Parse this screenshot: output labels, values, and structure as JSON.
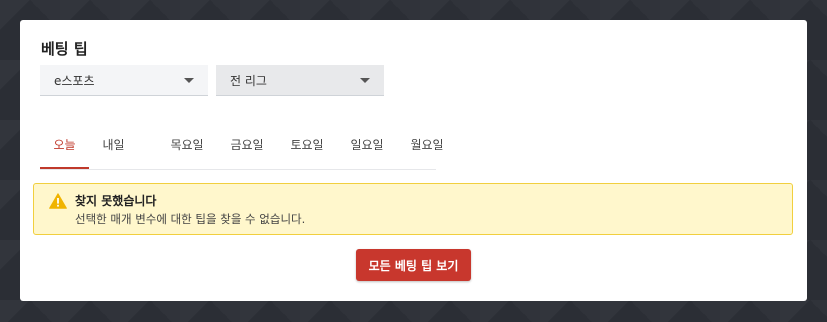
{
  "card": {
    "title": "베팅 팁"
  },
  "filters": {
    "sport": {
      "selected": "e스포츠"
    },
    "league": {
      "selected": "전 리그"
    }
  },
  "tabs": [
    {
      "label": "오늘",
      "active": true
    },
    {
      "label": "내일",
      "active": false
    },
    {
      "label": "목요일",
      "active": false
    },
    {
      "label": "금요일",
      "active": false
    },
    {
      "label": "토요일",
      "active": false
    },
    {
      "label": "일요일",
      "active": false
    },
    {
      "label": "월요일",
      "active": false
    }
  ],
  "alert": {
    "icon": "warning-icon",
    "title": "찾지 못했습니다",
    "message": "선택한 매개 변수에 대한 팁을 찾을 수 없습니다."
  },
  "cta": {
    "label": "모든 베팅 팁 보기"
  },
  "colors": {
    "accent": "#c8372d",
    "alert_bg": "#fff7cc",
    "alert_border": "#f1cf3e",
    "warning": "#f0b400"
  }
}
